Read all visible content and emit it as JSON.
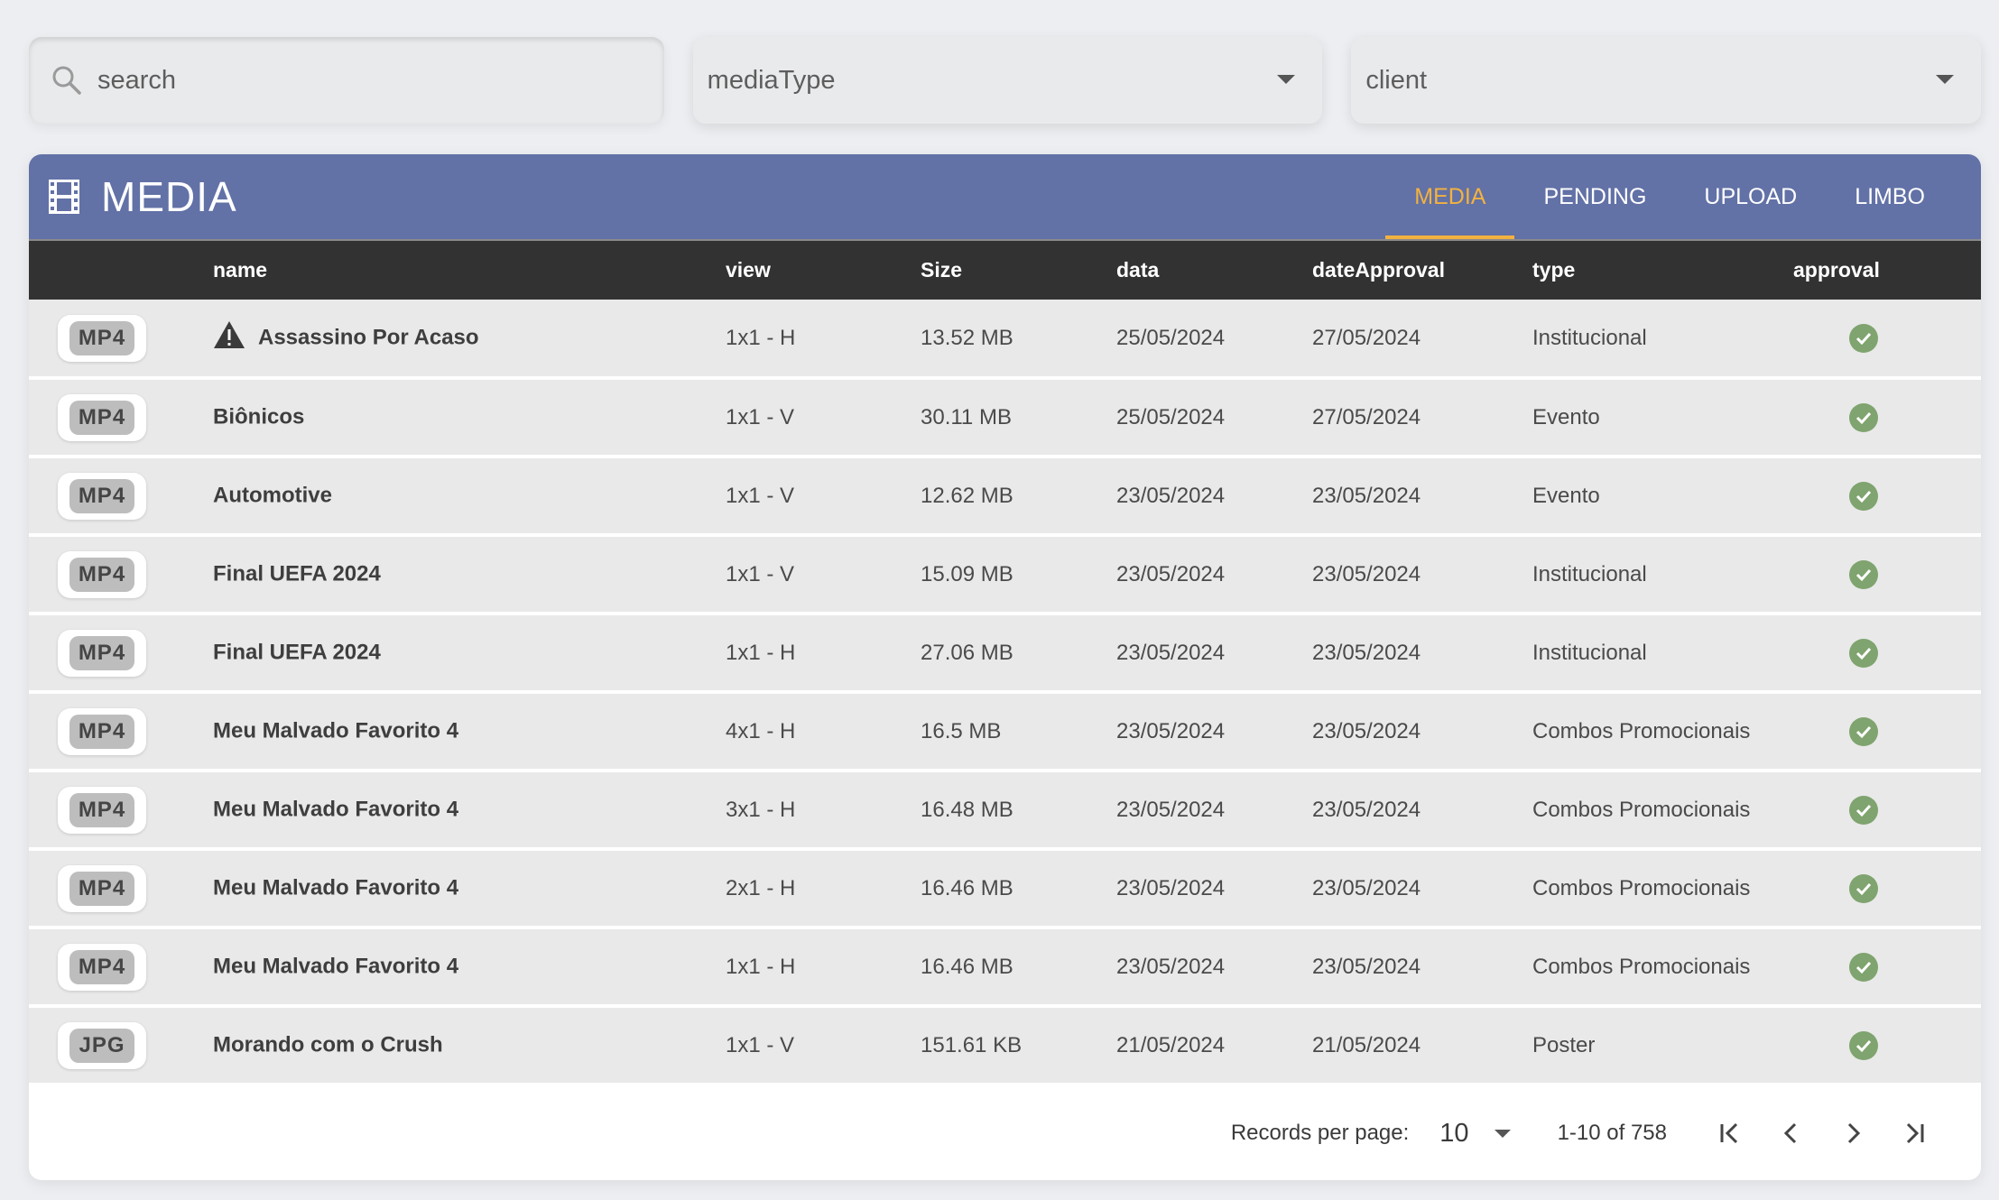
{
  "filters": {
    "search_placeholder": "search",
    "media_type_label": "mediaType",
    "client_label": "client"
  },
  "header": {
    "title": "MEDIA",
    "tabs": [
      {
        "label": "MEDIA",
        "active": true
      },
      {
        "label": "PENDING",
        "active": false
      },
      {
        "label": "UPLOAD",
        "active": false
      },
      {
        "label": "LIMBO",
        "active": false
      }
    ]
  },
  "table": {
    "columns": [
      "name",
      "view",
      "Size",
      "data",
      "dateApproval",
      "type",
      "approval"
    ],
    "rows": [
      {
        "format": "MP4",
        "warning": true,
        "name": "Assassino Por Acaso",
        "view": "1x1 - H",
        "size": "13.52 MB",
        "data": "25/05/2024",
        "dateApproval": "27/05/2024",
        "type": "Institucional",
        "approved": true
      },
      {
        "format": "MP4",
        "warning": false,
        "name": "Biônicos",
        "view": "1x1 - V",
        "size": "30.11 MB",
        "data": "25/05/2024",
        "dateApproval": "27/05/2024",
        "type": "Evento",
        "approved": true
      },
      {
        "format": "MP4",
        "warning": false,
        "name": "Automotive",
        "view": "1x1 - V",
        "size": "12.62 MB",
        "data": "23/05/2024",
        "dateApproval": "23/05/2024",
        "type": "Evento",
        "approved": true
      },
      {
        "format": "MP4",
        "warning": false,
        "name": "Final UEFA 2024",
        "view": "1x1 - V",
        "size": "15.09 MB",
        "data": "23/05/2024",
        "dateApproval": "23/05/2024",
        "type": "Institucional",
        "approved": true
      },
      {
        "format": "MP4",
        "warning": false,
        "name": "Final UEFA 2024",
        "view": "1x1 - H",
        "size": "27.06 MB",
        "data": "23/05/2024",
        "dateApproval": "23/05/2024",
        "type": "Institucional",
        "approved": true
      },
      {
        "format": "MP4",
        "warning": false,
        "name": "Meu Malvado Favorito 4",
        "view": "4x1 - H",
        "size": "16.5 MB",
        "data": "23/05/2024",
        "dateApproval": "23/05/2024",
        "type": "Combos Promocionais",
        "approved": true
      },
      {
        "format": "MP4",
        "warning": false,
        "name": "Meu Malvado Favorito 4",
        "view": "3x1 - H",
        "size": "16.48 MB",
        "data": "23/05/2024",
        "dateApproval": "23/05/2024",
        "type": "Combos Promocionais",
        "approved": true
      },
      {
        "format": "MP4",
        "warning": false,
        "name": "Meu Malvado Favorito 4",
        "view": "2x1 - H",
        "size": "16.46 MB",
        "data": "23/05/2024",
        "dateApproval": "23/05/2024",
        "type": "Combos Promocionais",
        "approved": true
      },
      {
        "format": "MP4",
        "warning": false,
        "name": "Meu Malvado Favorito 4",
        "view": "1x1 - H",
        "size": "16.46 MB",
        "data": "23/05/2024",
        "dateApproval": "23/05/2024",
        "type": "Combos Promocionais",
        "approved": true
      },
      {
        "format": "JPG",
        "warning": false,
        "name": "Morando com o Crush",
        "view": "1x1 - V",
        "size": "151.61 KB",
        "data": "21/05/2024",
        "dateApproval": "21/05/2024",
        "type": "Poster",
        "approved": true
      }
    ]
  },
  "pagination": {
    "records_label": "Records per page:",
    "per_page": "10",
    "range": "1-10 of 758"
  },
  "colors": {
    "header_bg": "#6271a6",
    "active_tab": "#f3b23f",
    "approved": "#7fa46f"
  }
}
